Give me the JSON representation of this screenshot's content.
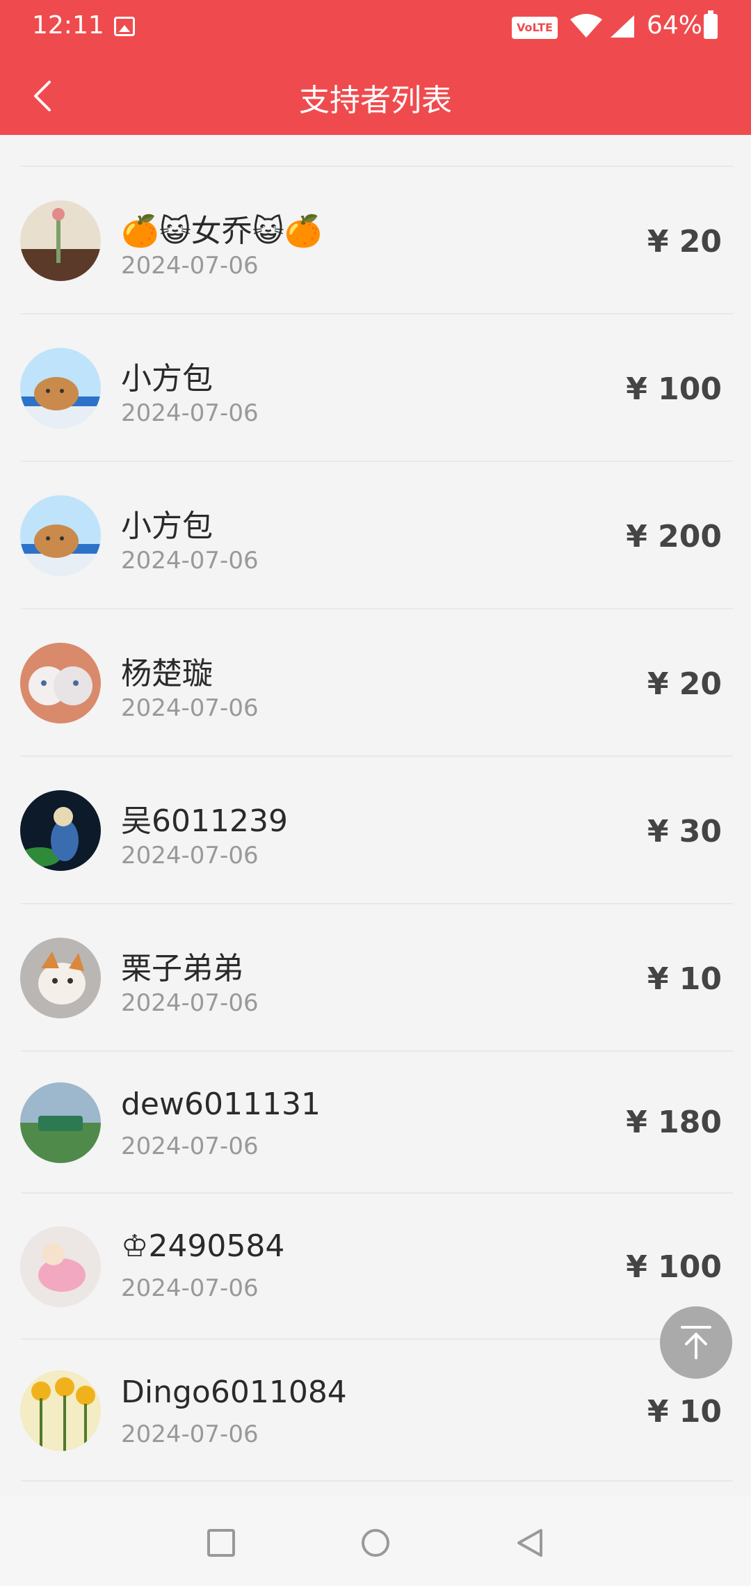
{
  "status_bar": {
    "time": "12:11",
    "volte": "VoLTE",
    "battery": "64%"
  },
  "app_bar": {
    "title": "支持者列表"
  },
  "supporters": [
    {
      "name": "🍊😺女乔😺🍊",
      "date": "2024-07-06",
      "amount": "¥ 20"
    },
    {
      "name": "小方包",
      "date": "2024-07-06",
      "amount": "¥ 100"
    },
    {
      "name": "小方包",
      "date": "2024-07-06",
      "amount": "¥ 200"
    },
    {
      "name": "杨楚璇",
      "date": "2024-07-06",
      "amount": "¥ 20"
    },
    {
      "name": "吴6011239",
      "date": "2024-07-06",
      "amount": "¥ 30"
    },
    {
      "name": "栗子弟弟",
      "date": "2024-07-06",
      "amount": "¥ 10"
    },
    {
      "name": "dew6011131",
      "date": "2024-07-06",
      "amount": "¥ 180"
    },
    {
      "name": "♔2490584",
      "date": "2024-07-06",
      "amount": "¥ 100"
    },
    {
      "name": "Dingo6011084",
      "date": "2024-07-06",
      "amount": "¥ 10"
    }
  ],
  "colors": {
    "primary": "#ef4b4e",
    "background": "#f4f4f4",
    "amount_text": "#444444",
    "date_text": "#999999"
  },
  "icons": {
    "back": "chevron-left-icon",
    "scroll_top": "arrow-up-to-top-icon",
    "nav": [
      "square-recents-icon",
      "circle-home-icon",
      "triangle-back-icon"
    ]
  }
}
